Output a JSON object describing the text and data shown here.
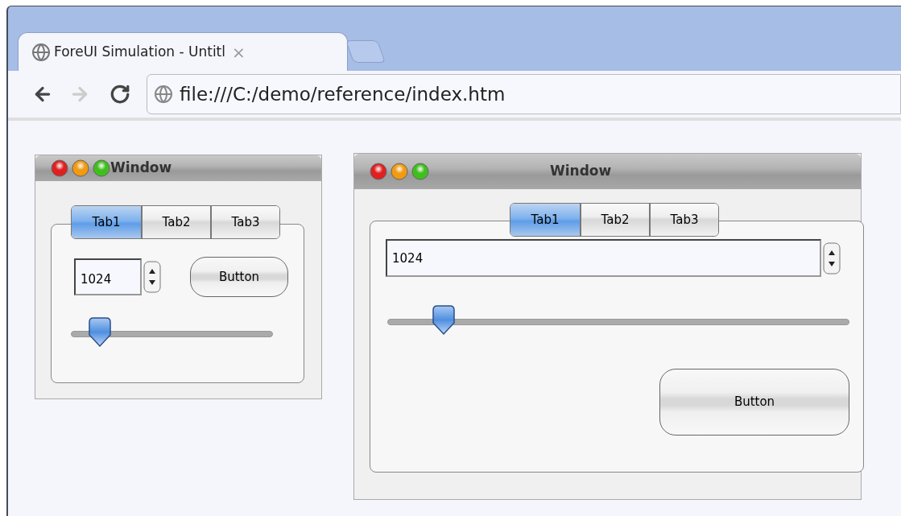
{
  "browser": {
    "tab": {
      "title": "ForeUI Simulation - Untitl",
      "close": "×"
    },
    "address": "file:///C:/demo/reference/index.htm"
  },
  "windows": [
    {
      "kind": "compact",
      "title": "Window",
      "tabs": [
        {
          "label": "Tab1",
          "selected": true
        },
        {
          "label": "Tab2",
          "selected": false
        },
        {
          "label": "Tab3",
          "selected": false
        }
      ],
      "spinner": {
        "value": "1024"
      },
      "slider": {
        "level": 0.14
      },
      "button": "Button"
    },
    {
      "kind": "wide",
      "title": "Window",
      "tabs": [
        {
          "label": "Tab1",
          "selected": true
        },
        {
          "label": "Tab2",
          "selected": false
        },
        {
          "label": "Tab3",
          "selected": false
        }
      ],
      "spinner": {
        "value": "1024"
      },
      "slider": {
        "level": 0.12
      },
      "button": "Button"
    }
  ]
}
